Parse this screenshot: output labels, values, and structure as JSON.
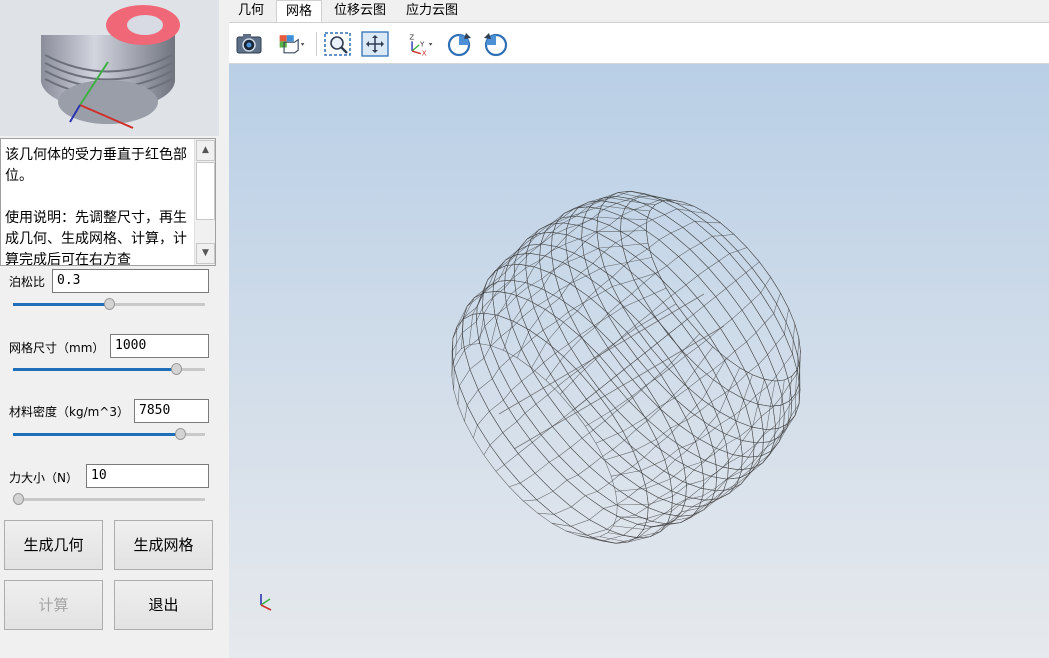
{
  "description": {
    "text": "该几何体的受力垂直于红色部位。\n\n使用说明：先调整尺寸，再生成几何、生成网格、计算，计算完成后可在右方查"
  },
  "params": {
    "poisson": {
      "label": "泊松比",
      "value": "0.3",
      "slider_fraction": 0.5
    },
    "mesh_size": {
      "label": "网格尺寸（mm）",
      "value": "1000",
      "slider_fraction": 0.85
    },
    "density": {
      "label": "材料密度（kg/m^3）",
      "value": "7850",
      "slider_fraction": 0.87
    },
    "force": {
      "label": "力大小（N）",
      "value": "10",
      "slider_fraction": 0.0
    }
  },
  "buttons": {
    "gen_geometry": "生成几何",
    "gen_mesh": "生成网格",
    "compute": "计算",
    "exit": "退出"
  },
  "tabs": [
    "几何",
    "网格",
    "位移云图",
    "应力云图"
  ],
  "active_tab": 1,
  "toolbar": {
    "icons": [
      "camera-icon",
      "view-cube-icon",
      "zoom-window-icon",
      "fit-all-icon",
      "axes-icon",
      "rotate-cw-icon",
      "rotate-ccw-icon"
    ]
  },
  "colors": {
    "accent": "#1f6fb8",
    "highlight": "#f06878"
  }
}
